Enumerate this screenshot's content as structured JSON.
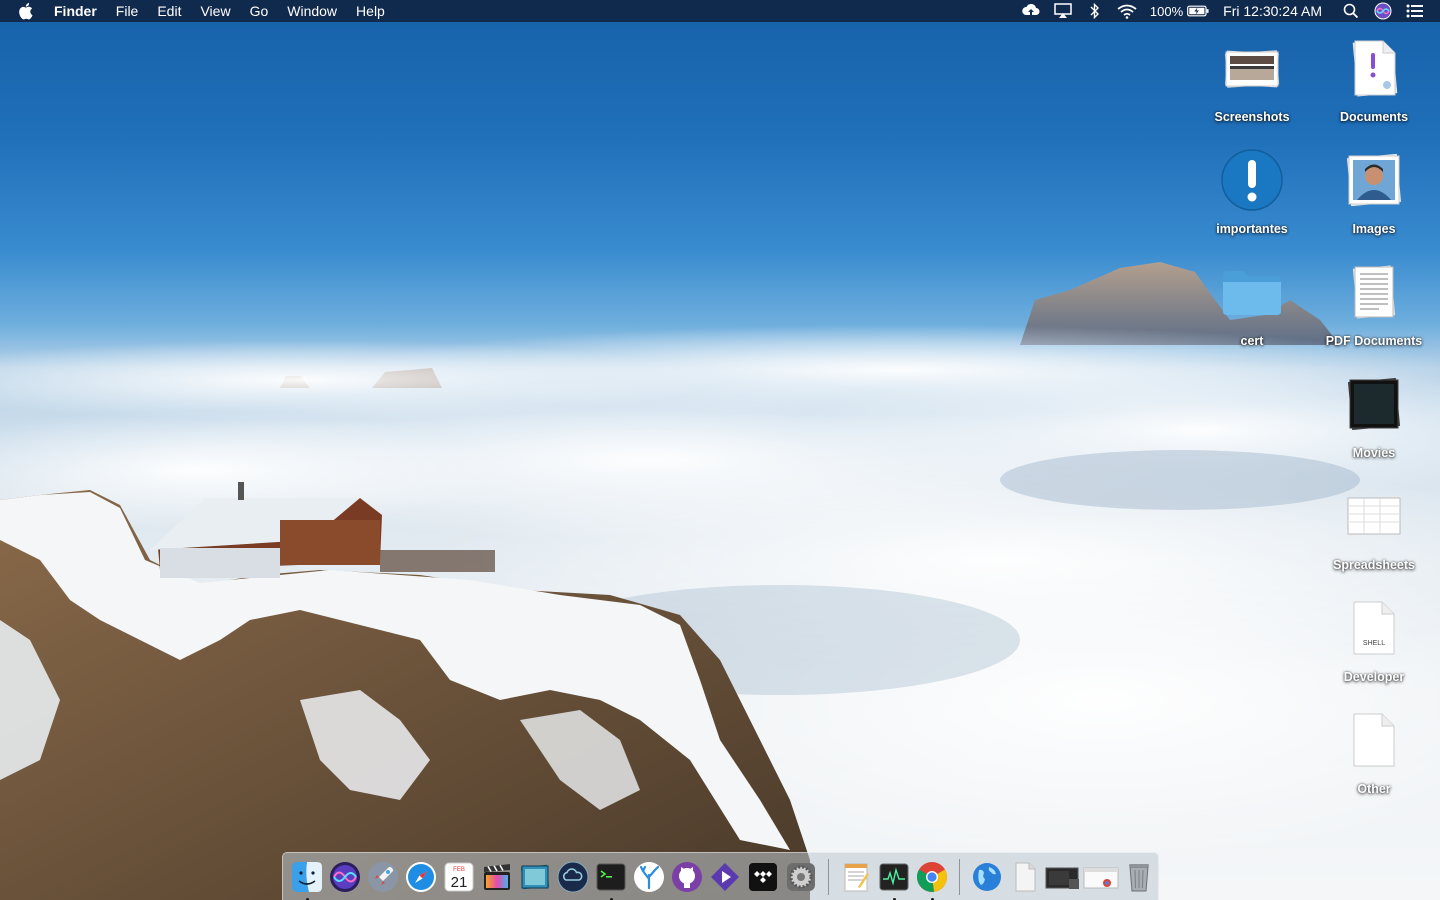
{
  "menubar": {
    "app_name": "Finder",
    "menus": [
      "File",
      "Edit",
      "View",
      "Go",
      "Window",
      "Help"
    ],
    "battery": "100%",
    "clock": "Fri 12:30:24 AM"
  },
  "desktop_icons": [
    {
      "label": "Screenshots",
      "icon": "screenshots-stack-icon"
    },
    {
      "label": "Documents",
      "icon": "documents-stack-icon"
    },
    {
      "label": "importantes",
      "icon": "exclamation-icon"
    },
    {
      "label": "Images",
      "icon": "images-stack-icon"
    },
    {
      "label": "cert",
      "icon": "folder-icon"
    },
    {
      "label": "PDF Documents",
      "icon": "pdf-stack-icon"
    },
    {
      "label": "Movies",
      "icon": "movies-stack-icon"
    },
    {
      "label": "Spreadsheets",
      "icon": "spreadsheets-stack-icon"
    },
    {
      "label": "Developer",
      "icon": "shell-script-icon"
    },
    {
      "label": "Other",
      "icon": "blank-document-icon"
    }
  ],
  "dock": {
    "apps": [
      "finder",
      "siri",
      "launchpad",
      "safari",
      "calendar",
      "final-cut",
      "preview",
      "screen-share",
      "terminal",
      "sourcetree",
      "github",
      "affinity",
      "tidal",
      "system-preferences"
    ],
    "calendar_month": "FEB",
    "calendar_day": "21",
    "shell_label": "SHELL"
  },
  "colors": {
    "menubar": "#102a4d",
    "sky_top": "#1761a8",
    "folder_blue": "#5fb2e6"
  }
}
